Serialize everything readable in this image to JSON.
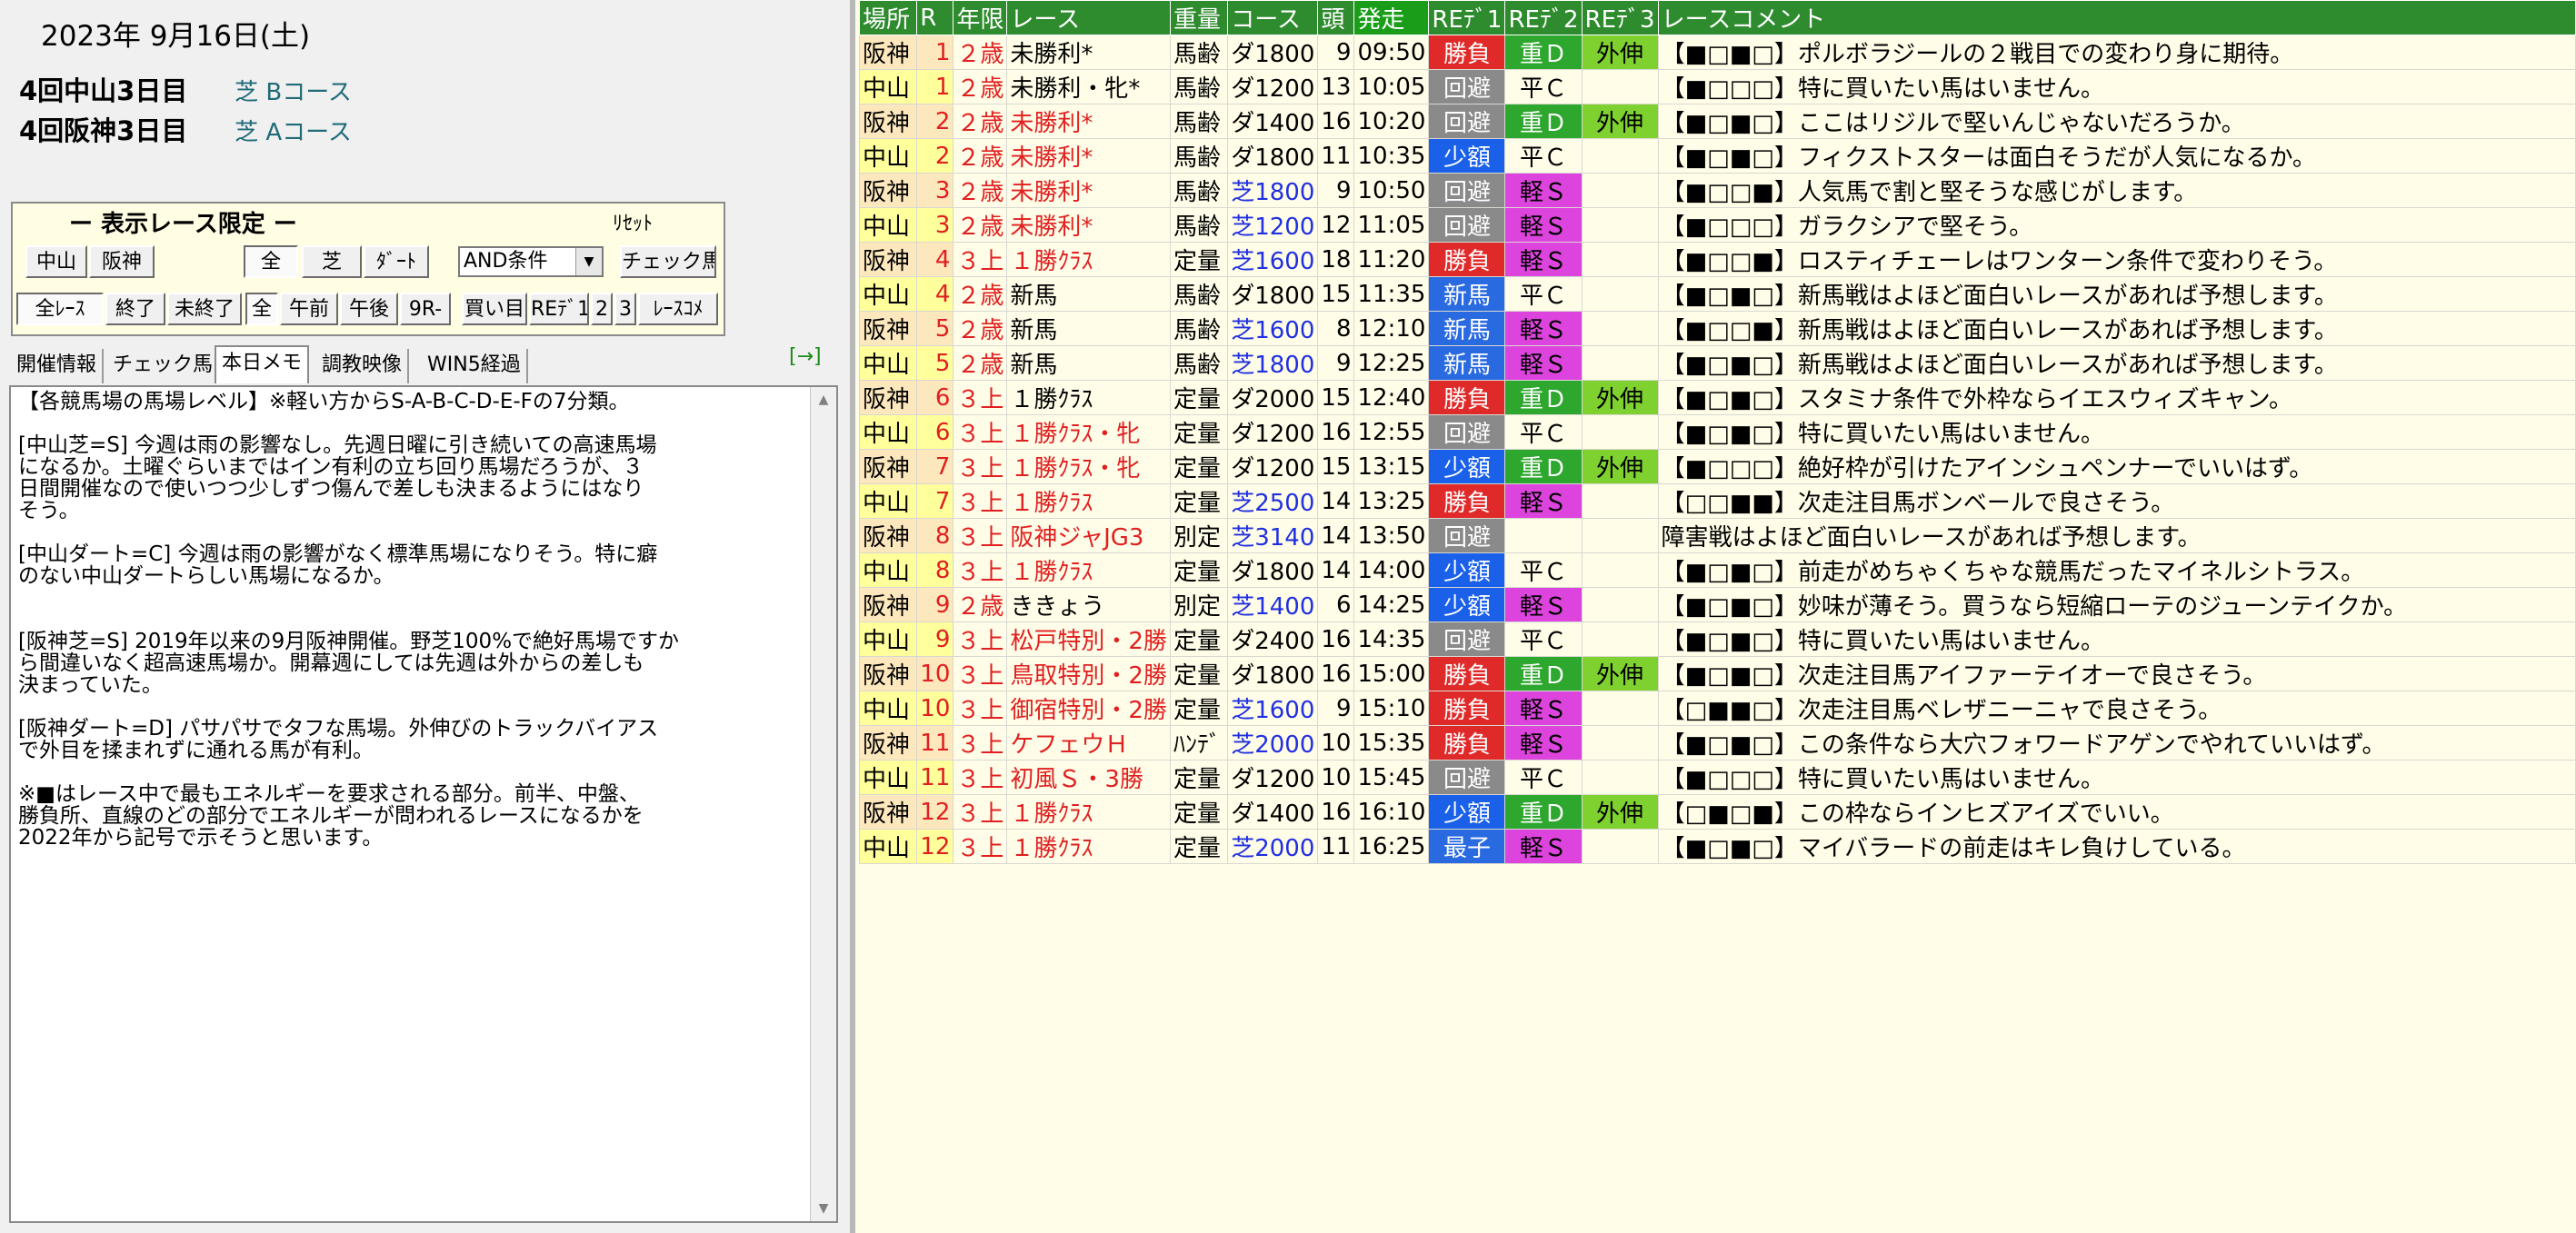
{
  "header": {
    "date": "2023年 9月16日(土)",
    "venues": [
      {
        "name": "4回中山3日目",
        "course": "芝 Bコース"
      },
      {
        "name": "4回阪神3日目",
        "course": "芝 Aコース"
      }
    ]
  },
  "filter_panel": {
    "title": "ー 表示レース限定 ー",
    "reset_label": "ﾘｾｯﾄ",
    "row1": {
      "nakayama": "中山",
      "hanshin": "阪神",
      "all": "全",
      "turf": "芝",
      "dirt": "ﾀﾞｰﾄ",
      "and_select": "AND条件",
      "check_horse": "チェック馬"
    },
    "row2": {
      "all_races": "全ﾚｰｽ",
      "finished": "終了",
      "unfinished": "未終了",
      "all": "全",
      "am": "午前",
      "pm": "午後",
      "9r": "9R-",
      "bet": "買い目",
      "red1": "REﾃﾞ1",
      "d2": "2",
      "d3": "3",
      "race_comment": "ﾚｰｽｺﾒ"
    }
  },
  "tabs": [
    "開催情報",
    "チェック馬",
    "本日メモ",
    "調教映像",
    "WIN5経過"
  ],
  "tab_arrow": "[→]",
  "memo_text": "【各競馬場の馬場レベル】※軽い方からS-A-B-C-D-E-Fの7分類。\n\n[中山芝=S] 今週は雨の影響なし。先週日曜に引き続いての高速馬場\nになるか。土曜ぐらいまではイン有利の立ち回り馬場だろうが、３\n日間開催なので使いつつ少しずつ傷んで差しも決まるようにはなり\nそう。\n\n[中山ダート=C] 今週は雨の影響がなく標準馬場になりそう。特に癖\nのない中山ダートらしい馬場になるか。\n\n\n[阪神芝=S] 2019年以来の9月阪神開催。野芝100%で絶好馬場ですか\nら間違いなく超高速馬場か。開幕週にしては先週は外からの差しも\n決まっていた。\n\n[阪神ダート=D] パサパサでタフな馬場。外伸びのトラックバイアス\nで外目を揉まれずに通れる馬が有利。\n\n※■はレース中で最もエネルギーを要求される部分。前半、中盤、\n勝負所、直線のどの部分でエネルギーが問われるレースになるかを\n2022年から記号で示そうと思います。",
  "columns": [
    "場所",
    "R",
    "年限",
    "レース",
    "重量",
    "コース",
    "頭",
    "発走",
    "REﾃﾞ1",
    "REﾃﾞ2",
    "REﾃﾞ3",
    "レースコメント"
  ],
  "races": [
    {
      "venue": "阪神",
      "r": "1",
      "age": "２歳",
      "name": "未勝利*",
      "weight": "馬齢",
      "course": "ダ1800",
      "heads": "9",
      "time": "09:50",
      "rd1": "勝負",
      "rd2": "重Ｄ",
      "rd3": "外伸",
      "comment": "【■□■□】ポルボラジールの２戦目での変わり身に期待。"
    },
    {
      "venue": "中山",
      "r": "1",
      "age": "２歳",
      "name": "未勝利・牝*",
      "weight": "馬齢",
      "course": "ダ1200",
      "heads": "13",
      "time": "10:05",
      "rd1": "回避",
      "rd2": "平Ｃ",
      "rd3": "",
      "comment": "【■□□□】特に買いたい馬はいません。"
    },
    {
      "venue": "阪神",
      "r": "2",
      "age": "２歳",
      "name": "未勝利*",
      "weight": "馬齢",
      "course": "ダ1400",
      "heads": "16",
      "time": "10:20",
      "rd1": "回避",
      "rd2": "重Ｄ",
      "rd3": "外伸",
      "comment": "【■□■□】ここはリジルで堅いんじゃないだろうか。"
    },
    {
      "venue": "中山",
      "r": "2",
      "age": "２歳",
      "name": "未勝利*",
      "weight": "馬齢",
      "course": "ダ1800",
      "heads": "11",
      "time": "10:35",
      "rd1": "少額",
      "rd2": "平Ｃ",
      "rd3": "",
      "comment": "【■□■□】フィクストスターは面白そうだが人気になるか。"
    },
    {
      "venue": "阪神",
      "r": "3",
      "age": "２歳",
      "name": "未勝利*",
      "weight": "馬齢",
      "course": "芝1800",
      "heads": "9",
      "time": "10:50",
      "rd1": "回避",
      "rd2": "軽Ｓ",
      "rd3": "",
      "comment": "【■□□■】人気馬で割と堅そうな感じがします。"
    },
    {
      "venue": "中山",
      "r": "3",
      "age": "２歳",
      "name": "未勝利*",
      "weight": "馬齢",
      "course": "芝1200",
      "heads": "12",
      "time": "11:05",
      "rd1": "回避",
      "rd2": "軽Ｓ",
      "rd3": "",
      "comment": "【■□□□】ガラクシアで堅そう。"
    },
    {
      "venue": "阪神",
      "r": "4",
      "age": "３上",
      "name": "１勝ｸﾗｽ",
      "weight": "定量",
      "course": "芝1600",
      "heads": "18",
      "time": "11:20",
      "rd1": "勝負",
      "rd2": "軽Ｓ",
      "rd3": "",
      "comment": "【■□□■】ロスティチェーレはワンターン条件で変わりそう。"
    },
    {
      "venue": "中山",
      "r": "4",
      "age": "２歳",
      "name": "新馬",
      "weight": "馬齢",
      "course": "ダ1800",
      "heads": "15",
      "time": "11:35",
      "rd1": "新馬",
      "rd2": "平Ｃ",
      "rd3": "",
      "comment": "【■□■□】新馬戦はよほど面白いレースがあれば予想します。"
    },
    {
      "venue": "阪神",
      "r": "5",
      "age": "２歳",
      "name": "新馬",
      "weight": "馬齢",
      "course": "芝1600",
      "heads": "8",
      "time": "12:10",
      "rd1": "新馬",
      "rd2": "軽Ｓ",
      "rd3": "",
      "comment": "【■□□■】新馬戦はよほど面白いレースがあれば予想します。"
    },
    {
      "venue": "中山",
      "r": "5",
      "age": "２歳",
      "name": "新馬",
      "weight": "馬齢",
      "course": "芝1800",
      "heads": "9",
      "time": "12:25",
      "rd1": "新馬",
      "rd2": "軽Ｓ",
      "rd3": "",
      "comment": "【■□■□】新馬戦はよほど面白いレースがあれば予想します。"
    },
    {
      "venue": "阪神",
      "r": "6",
      "age": "３上",
      "name": "１勝ｸﾗｽ",
      "weight": "定量",
      "course": "ダ2000",
      "heads": "15",
      "time": "12:40",
      "rd1": "勝負",
      "rd2": "重Ｄ",
      "rd3": "外伸",
      "comment": "【■□■□】スタミナ条件で外枠ならイエスウィズキャン。"
    },
    {
      "venue": "中山",
      "r": "6",
      "age": "３上",
      "name": "１勝ｸﾗｽ・牝",
      "weight": "定量",
      "course": "ダ1200",
      "heads": "16",
      "time": "12:55",
      "rd1": "回避",
      "rd2": "平Ｃ",
      "rd3": "",
      "comment": "【■□■□】特に買いたい馬はいません。"
    },
    {
      "venue": "阪神",
      "r": "7",
      "age": "３上",
      "name": "１勝ｸﾗｽ・牝",
      "weight": "定量",
      "course": "ダ1200",
      "heads": "15",
      "time": "13:15",
      "rd1": "少額",
      "rd2": "重Ｄ",
      "rd3": "外伸",
      "comment": "【■□□□】絶好枠が引けたアインシュペンナーでいいはず。"
    },
    {
      "venue": "中山",
      "r": "7",
      "age": "３上",
      "name": "１勝ｸﾗｽ",
      "weight": "定量",
      "course": "芝2500",
      "heads": "14",
      "time": "13:25",
      "rd1": "勝負",
      "rd2": "軽Ｓ",
      "rd3": "",
      "comment": "【□□■■】次走注目馬ボンベールで良さそう。"
    },
    {
      "venue": "阪神",
      "r": "8",
      "age": "３上",
      "name": "阪神ジャJG3",
      "weight": "別定",
      "course": "芝3140",
      "heads": "14",
      "time": "13:50",
      "rd1": "回避",
      "rd2": "",
      "rd3": "",
      "comment": "障害戦はよほど面白いレースがあれば予想します。"
    },
    {
      "venue": "中山",
      "r": "8",
      "age": "３上",
      "name": "１勝ｸﾗｽ",
      "weight": "定量",
      "course": "ダ1800",
      "heads": "14",
      "time": "14:00",
      "rd1": "少額",
      "rd2": "平Ｃ",
      "rd3": "",
      "comment": "【■□■□】前走がめちゃくちゃな競馬だったマイネルシトラス。"
    },
    {
      "venue": "阪神",
      "r": "9",
      "age": "２歳",
      "name": "ききょう",
      "weight": "別定",
      "course": "芝1400",
      "heads": "6",
      "time": "14:25",
      "rd1": "少額",
      "rd2": "軽Ｓ",
      "rd3": "",
      "comment": "【■□■□】妙味が薄そう。買うなら短縮ローテのジューンテイクか。"
    },
    {
      "venue": "中山",
      "r": "9",
      "age": "３上",
      "name": "松戸特別・2勝",
      "weight": "定量",
      "course": "ダ2400",
      "heads": "16",
      "time": "14:35",
      "rd1": "回避",
      "rd2": "平Ｃ",
      "rd3": "",
      "comment": "【■□■□】特に買いたい馬はいません。"
    },
    {
      "venue": "阪神",
      "r": "10",
      "age": "３上",
      "name": "鳥取特別・2勝",
      "weight": "定量",
      "course": "ダ1800",
      "heads": "16",
      "time": "15:00",
      "rd1": "勝負",
      "rd2": "重Ｄ",
      "rd3": "外伸",
      "comment": "【■□■□】次走注目馬アイファーテイオーで良さそう。"
    },
    {
      "venue": "中山",
      "r": "10",
      "age": "３上",
      "name": "御宿特別・2勝",
      "weight": "定量",
      "course": "芝1600",
      "heads": "9",
      "time": "15:10",
      "rd1": "勝負",
      "rd2": "軽Ｓ",
      "rd3": "",
      "comment": "【□■■□】次走注目馬ベレザニーニャで良さそう。"
    },
    {
      "venue": "阪神",
      "r": "11",
      "age": "３上",
      "name": "ケフェウＨ",
      "weight": "ﾊﾝﾃﾞ",
      "course": "芝2000",
      "heads": "10",
      "time": "15:35",
      "rd1": "勝負",
      "rd2": "軽Ｓ",
      "rd3": "",
      "comment": "【■□■□】この条件なら大穴フォワードアゲンでやれていいはず。"
    },
    {
      "venue": "中山",
      "r": "11",
      "age": "３上",
      "name": "初風Ｓ・3勝",
      "weight": "定量",
      "course": "ダ1200",
      "heads": "10",
      "time": "15:45",
      "rd1": "回避",
      "rd2": "平Ｃ",
      "rd3": "",
      "comment": "【■□□□】特に買いたい馬はいません。"
    },
    {
      "venue": "阪神",
      "r": "12",
      "age": "３上",
      "name": "１勝ｸﾗｽ",
      "weight": "定量",
      "course": "ダ1400",
      "heads": "16",
      "time": "16:10",
      "rd1": "少額",
      "rd2": "重Ｄ",
      "rd3": "外伸",
      "comment": "【□■□■】この枠ならインヒズアイズでいい。"
    },
    {
      "venue": "中山",
      "r": "12",
      "age": "３上",
      "name": "１勝ｸﾗｽ",
      "weight": "定量",
      "course": "芝2000",
      "heads": "11",
      "time": "16:25",
      "rd1": "最子",
      "rd2": "軽Ｓ",
      "rd3": "",
      "comment": "【■□■□】マイバラードの前走はキレ負けしている。"
    }
  ]
}
